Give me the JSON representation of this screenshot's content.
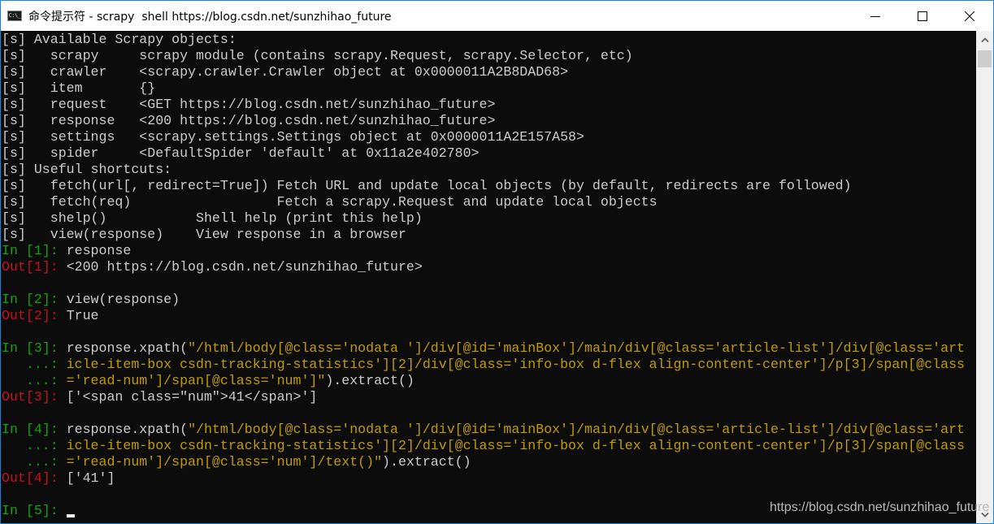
{
  "window": {
    "title": "命令提示符 - scrapy  shell https://blog.csdn.net/sunzhihao_future",
    "icon_label": "C:\\_",
    "controls": {
      "minimize": "minimize-icon",
      "maximize": "maximize-icon",
      "close": "close-icon"
    }
  },
  "colors": {
    "background": "#0c0c0c",
    "foreground": "#cccccc",
    "prompt_in": "#13a10e",
    "prompt_out": "#c50f1f",
    "string": "#c19c00",
    "window_border": "#1883d7"
  },
  "console": {
    "lines": [
      [
        {
          "t": "[s] Available Scrapy objects:",
          "c": "gray"
        }
      ],
      [
        {
          "t": "[s]   scrapy     scrapy module (contains scrapy.Request, scrapy.Selector, etc)",
          "c": "gray"
        }
      ],
      [
        {
          "t": "[s]   crawler    <scrapy.crawler.Crawler object at 0x0000011A2B8DAD68>",
          "c": "gray"
        }
      ],
      [
        {
          "t": "[s]   item       {}",
          "c": "gray"
        }
      ],
      [
        {
          "t": "[s]   request    <GET https://blog.csdn.net/sunzhihao_future>",
          "c": "gray"
        }
      ],
      [
        {
          "t": "[s]   response   <200 https://blog.csdn.net/sunzhihao_future>",
          "c": "gray"
        }
      ],
      [
        {
          "t": "[s]   settings   <scrapy.settings.Settings object at 0x0000011A2E157A58>",
          "c": "gray"
        }
      ],
      [
        {
          "t": "[s]   spider     <DefaultSpider 'default' at 0x11a2e402780>",
          "c": "gray"
        }
      ],
      [
        {
          "t": "[s] Useful shortcuts:",
          "c": "gray"
        }
      ],
      [
        {
          "t": "[s]   fetch(url[, redirect=True]) Fetch URL and update local objects (by default, redirects are followed)",
          "c": "gray"
        }
      ],
      [
        {
          "t": "[s]   fetch(req)                  Fetch a scrapy.Request and update local objects",
          "c": "gray"
        }
      ],
      [
        {
          "t": "[s]   shelp()           Shell help (print this help)",
          "c": "gray"
        }
      ],
      [
        {
          "t": "[s]   view(response)    View response in a browser",
          "c": "gray"
        }
      ],
      [
        {
          "t": "In [",
          "c": "green"
        },
        {
          "t": "1",
          "c": "green"
        },
        {
          "t": "]: ",
          "c": "green"
        },
        {
          "t": "response",
          "c": "gray"
        }
      ],
      [
        {
          "t": "Out[",
          "c": "red"
        },
        {
          "t": "1",
          "c": "red"
        },
        {
          "t": "]: ",
          "c": "red"
        },
        {
          "t": "<200 https://blog.csdn.net/sunzhihao_future>",
          "c": "gray"
        }
      ],
      [
        {
          "t": "",
          "c": "gray"
        }
      ],
      [
        {
          "t": "In [",
          "c": "green"
        },
        {
          "t": "2",
          "c": "green"
        },
        {
          "t": "]: ",
          "c": "green"
        },
        {
          "t": "view(response)",
          "c": "gray"
        }
      ],
      [
        {
          "t": "Out[",
          "c": "red"
        },
        {
          "t": "2",
          "c": "red"
        },
        {
          "t": "]: ",
          "c": "red"
        },
        {
          "t": "True",
          "c": "gray"
        }
      ],
      [
        {
          "t": "",
          "c": "gray"
        }
      ],
      [
        {
          "t": "In [",
          "c": "green"
        },
        {
          "t": "3",
          "c": "green"
        },
        {
          "t": "]: ",
          "c": "green"
        },
        {
          "t": "response.xpath(",
          "c": "gray"
        },
        {
          "t": "\"/html/body[@class='nodata ']/div[@id='mainBox']/main/div[@class='article-list']/div[@class='art",
          "c": "yellow"
        }
      ],
      [
        {
          "t": "   ...: ",
          "c": "green"
        },
        {
          "t": "icle-item-box csdn-tracking-statistics'][2]/div[@class='info-box d-flex align-content-center']/p[3]/span[@class",
          "c": "yellow"
        }
      ],
      [
        {
          "t": "   ...: ",
          "c": "green"
        },
        {
          "t": "='read-num']/span[@class='num']\"",
          "c": "yellow"
        },
        {
          "t": ").extract()",
          "c": "gray"
        }
      ],
      [
        {
          "t": "Out[",
          "c": "red"
        },
        {
          "t": "3",
          "c": "red"
        },
        {
          "t": "]: ",
          "c": "red"
        },
        {
          "t": "['<span class=\"num\">41</span>']",
          "c": "gray"
        }
      ],
      [
        {
          "t": "",
          "c": "gray"
        }
      ],
      [
        {
          "t": "In [",
          "c": "green"
        },
        {
          "t": "4",
          "c": "green"
        },
        {
          "t": "]: ",
          "c": "green"
        },
        {
          "t": "response.xpath(",
          "c": "gray"
        },
        {
          "t": "\"/html/body[@class='nodata ']/div[@id='mainBox']/main/div[@class='article-list']/div[@class='art",
          "c": "yellow"
        }
      ],
      [
        {
          "t": "   ...: ",
          "c": "green"
        },
        {
          "t": "icle-item-box csdn-tracking-statistics'][2]/div[@class='info-box d-flex align-content-center']/p[3]/span[@class",
          "c": "yellow"
        }
      ],
      [
        {
          "t": "   ...: ",
          "c": "green"
        },
        {
          "t": "='read-num']/span[@class='num']/text()\"",
          "c": "yellow"
        },
        {
          "t": ").extract()",
          "c": "gray"
        }
      ],
      [
        {
          "t": "Out[",
          "c": "red"
        },
        {
          "t": "4",
          "c": "red"
        },
        {
          "t": "]: ",
          "c": "red"
        },
        {
          "t": "['41']",
          "c": "gray"
        }
      ],
      [
        {
          "t": "",
          "c": "gray"
        }
      ],
      [
        {
          "t": "In [",
          "c": "green"
        },
        {
          "t": "5",
          "c": "green"
        },
        {
          "t": "]: ",
          "c": "green"
        }
      ]
    ],
    "input_current_value": "",
    "cursor": "block-cursor"
  },
  "watermark": "https://blog.csdn.net/sunzhihao_future",
  "scrollbar": {
    "up_icon": "chevron-up-icon",
    "down_icon": "chevron-down-icon",
    "position": "top"
  }
}
